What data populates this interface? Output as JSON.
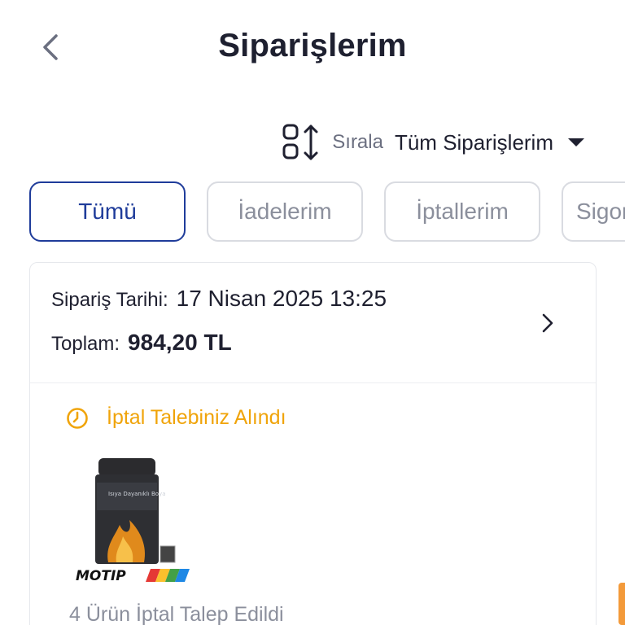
{
  "header": {
    "title": "Siparişlerim",
    "back_icon": "chevron-left-icon"
  },
  "sort": {
    "icon": "sort-arrows-icon",
    "label": "Sırala",
    "value": "Tüm Siparişlerim",
    "caret_icon": "caret-down-icon"
  },
  "tabs": [
    {
      "label": "Tümü",
      "active": true
    },
    {
      "label": "İadelerim",
      "active": false
    },
    {
      "label": "İptallerim",
      "active": false
    },
    {
      "label": "Sigor",
      "active": false
    }
  ],
  "order": {
    "date_label": "Sipariş Tarihi:",
    "date_value": "17 Nisan 2025 13:25",
    "total_label": "Toplam:",
    "total_value": "984,20 TL",
    "status_icon": "clock-icon",
    "status_text": "İptal Talebiniz Alındı",
    "product_brand": "MOTIP",
    "product_can_text": "Isıya Dayanıklı Boya",
    "item_count_text": "4 Ürün İptal Talep Edildi"
  },
  "colors": {
    "accent": "#1f3c9a",
    "status": "#f0a40a",
    "text": "#1f2030",
    "muted": "#8b8f9c",
    "border": "#d9dbe1",
    "side_strip": "#f39a3a"
  }
}
